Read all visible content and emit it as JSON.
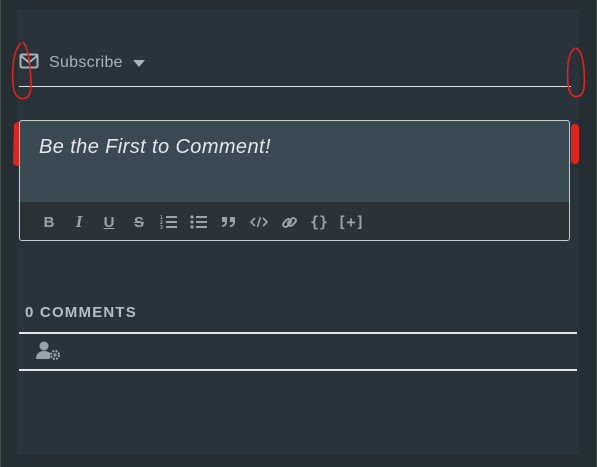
{
  "subscribe": {
    "icon": "envelope-icon",
    "label": "Subscribe",
    "caret_icon": "caret-down-icon"
  },
  "editor": {
    "placeholder": "Be the First to Comment!",
    "toolbar": [
      {
        "icon": "bold-icon",
        "text": "B"
      },
      {
        "icon": "italic-icon",
        "text": "I"
      },
      {
        "icon": "underline-icon",
        "text": "U"
      },
      {
        "icon": "strikethrough-icon",
        "text": "S"
      },
      {
        "icon": "ordered-list-icon"
      },
      {
        "icon": "unordered-list-icon"
      },
      {
        "icon": "blockquote-icon"
      },
      {
        "icon": "code-icon"
      },
      {
        "icon": "link-icon"
      },
      {
        "icon": "code-block-icon",
        "text": "{}"
      },
      {
        "icon": "spoiler-icon",
        "text": "[+]"
      }
    ]
  },
  "comments": {
    "count_label": "0 COMMENTS",
    "user_settings_icon": "user-gear-icon"
  },
  "colors": {
    "background": "#242e33",
    "panel": "#28333a",
    "editor_bg": "#3a4a52",
    "toolbar_bg": "#2c3337",
    "annotation_red": "#e8201c"
  }
}
